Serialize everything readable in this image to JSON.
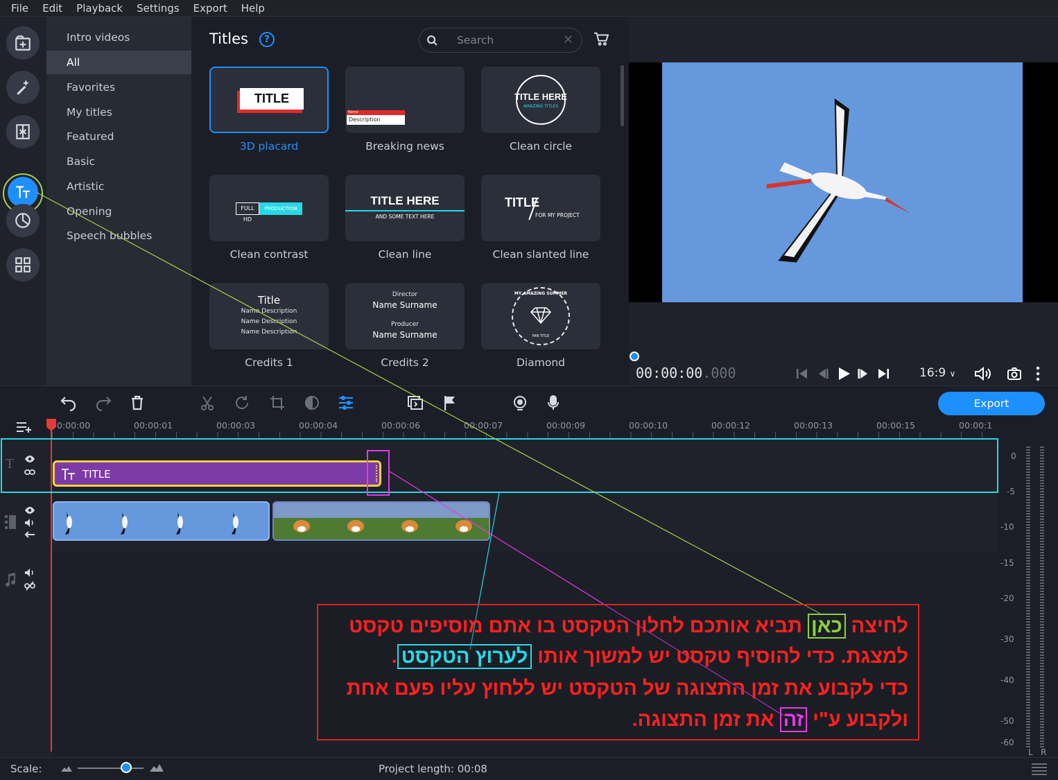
{
  "menu": [
    "File",
    "Edit",
    "Playback",
    "Settings",
    "Export",
    "Help"
  ],
  "toolstrip_icons": [
    "import-icon",
    "magic-wand-icon",
    "transitions-icon",
    "titles-icon",
    "stickers-icon",
    "more-tools-icon"
  ],
  "categories": [
    "Intro videos",
    "All",
    "Favorites",
    "My titles",
    "Featured",
    "Basic",
    "Artistic",
    "Opening",
    "Speech bubbles"
  ],
  "selected_category": "All",
  "library": {
    "title": "Titles",
    "help": "?",
    "search_placeholder": "Search",
    "items": [
      {
        "name": "3D placard",
        "thumb_text": "TITLE"
      },
      {
        "name": "Breaking news",
        "thumb_text": "Description",
        "thumb_text2": "Name"
      },
      {
        "name": "Clean circle",
        "thumb_text": "TITLE HERE",
        "thumb_text2": "AMAZING TITLES"
      },
      {
        "name": "Clean contrast",
        "thumb_text": "FULL HD",
        "thumb_text2": "PRODUCTION"
      },
      {
        "name": "Clean line",
        "thumb_text": "TITLE HERE",
        "thumb_text2": "AND SOME TEXT HERE"
      },
      {
        "name": "Clean slanted line",
        "thumb_text": "TITLE",
        "thumb_text2": "FOR MY PROJECT"
      },
      {
        "name": "Credits 1",
        "thumb_text": "Title",
        "thumb_lines": [
          "Name Description",
          "Name Description",
          "Name Description"
        ]
      },
      {
        "name": "Credits 2",
        "thumb_lines": [
          "Director",
          "Name Surname",
          "Producer",
          "Name Surname"
        ]
      },
      {
        "name": "Diamond",
        "thumb_text": "MY AMAZING SUMMER",
        "thumb_text2": "FAN TITLE"
      }
    ]
  },
  "player": {
    "timecode": "00:00:00",
    "timecode_ms": ".000",
    "aspect": "16:9"
  },
  "toolbar": {
    "export_label": "Export"
  },
  "ruler_labels": [
    "0:00:00",
    "00:00:01",
    "00:00:03",
    "00:00:04",
    "00:00:06",
    "00:00:07",
    "00:00:09",
    "00:00:10",
    "00:00:12",
    "00:00:13",
    "00:00:15",
    "00:00:1"
  ],
  "timeline": {
    "title_clip_label": "TITLE",
    "meter_labels": [
      "0",
      "-5",
      "-10",
      "-15",
      "-20",
      "-30",
      "-40",
      "-50",
      "-60"
    ],
    "meter_lr": [
      "L",
      "R"
    ]
  },
  "status": {
    "scale_label": "Scale:",
    "project_length_label": "Project length:",
    "project_length": "00:08"
  },
  "annotation": {
    "line1_pre": "לחיצה ",
    "line1_hl": "כאן",
    "line1_post": " תביא אותכם לחלון הטקסט בו אתם מוסיפים טקסט",
    "line2_pre": "למצגת. כדי להוסיף טקסט יש למשוך אותו ",
    "line2_hl": "לערוץ הטקסט",
    "line2_post": ".",
    "line3": "כדי לקבוע את זמן התצוגה של הטקסט יש ללחוץ עליו פעם אחת",
    "line4_pre": "ולקבוע ע\"י ",
    "line4_hl": "זה",
    "line4_post": " את זמן התצוגה.",
    "colors": {
      "text": "#ff2020",
      "green": "#8ed13c",
      "cyan": "#27d8e6",
      "magenta": "#e838e8"
    }
  }
}
